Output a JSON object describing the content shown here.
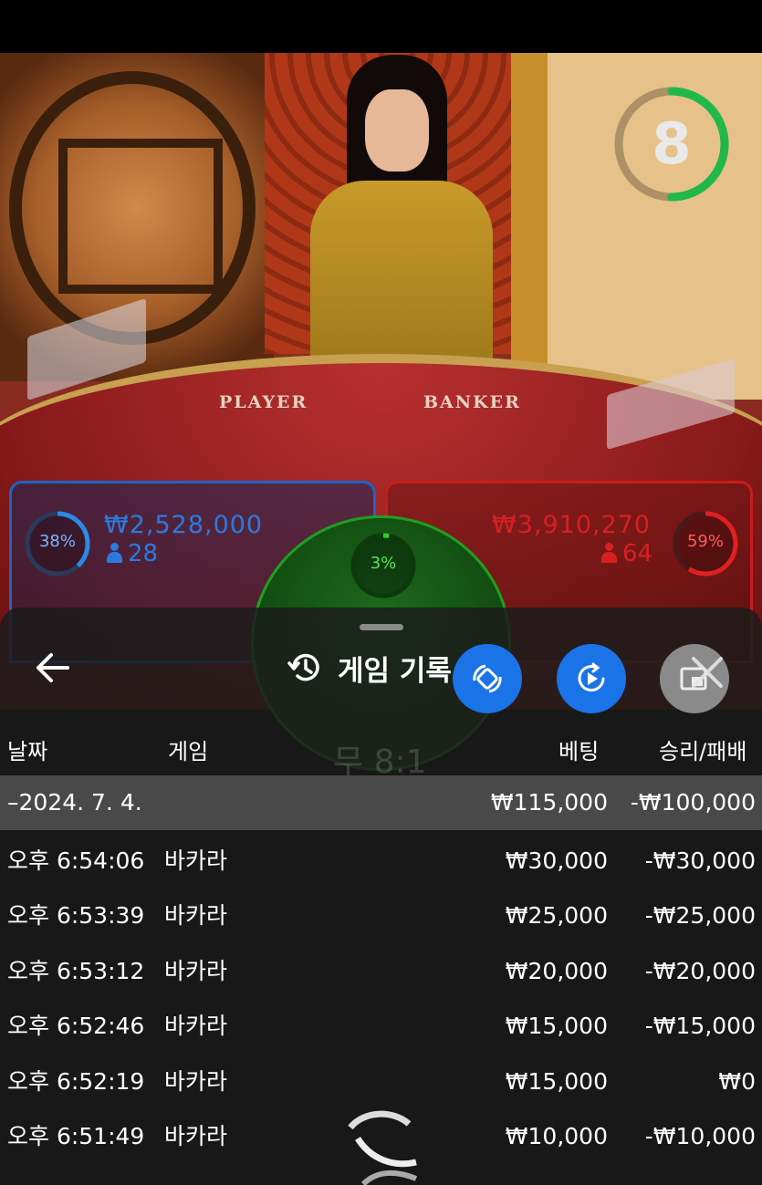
{
  "scene": {
    "table_labels": {
      "player": "PLAYER",
      "banker": "BANKER"
    },
    "countdown": {
      "value": "8",
      "fraction": 0.5
    }
  },
  "bets": {
    "player": {
      "percent": "38%",
      "amount": "₩2,528,000",
      "players": "28",
      "color": "#1e63c6"
    },
    "tie": {
      "percent": "3%",
      "color": "#1fa01f"
    },
    "banker": {
      "percent": "59%",
      "amount": "₩3,910,270",
      "players": "64",
      "color": "#c81c1c"
    }
  },
  "history": {
    "title": "게임 기록",
    "icons": {
      "back": "arrow-left-icon",
      "history": "history-clock-icon",
      "rotate": "rotate-icon",
      "play": "replay-icon",
      "pip": "picture-in-picture-icon",
      "close": "close-icon"
    },
    "columns": {
      "date": "날짜",
      "game": "게임",
      "bet": "베팅",
      "result": "승리/패배"
    },
    "summary": {
      "date": "–2024. 7. 4.",
      "bet": "₩115,000",
      "result": "-₩100,000"
    },
    "rows": [
      {
        "time": "오후 6:54:06",
        "game": "바카라",
        "bet": "₩30,000",
        "result": "-₩30,000"
      },
      {
        "time": "오후 6:53:39",
        "game": "바카라",
        "bet": "₩25,000",
        "result": "-₩25,000"
      },
      {
        "time": "오후 6:53:12",
        "game": "바카라",
        "bet": "₩20,000",
        "result": "-₩20,000"
      },
      {
        "time": "오후 6:52:46",
        "game": "바카라",
        "bet": "₩15,000",
        "result": "-₩15,000"
      },
      {
        "time": "오후 6:52:19",
        "game": "바카라",
        "bet": "₩15,000",
        "result": "₩0"
      },
      {
        "time": "오후 6:51:49",
        "game": "바카라",
        "bet": "₩10,000",
        "result": "-₩10,000"
      }
    ]
  },
  "colors": {
    "accent_blue": "#1b73e8",
    "sheet_bg": "#1c1c1c",
    "summary_row": "#5a5a5a"
  }
}
